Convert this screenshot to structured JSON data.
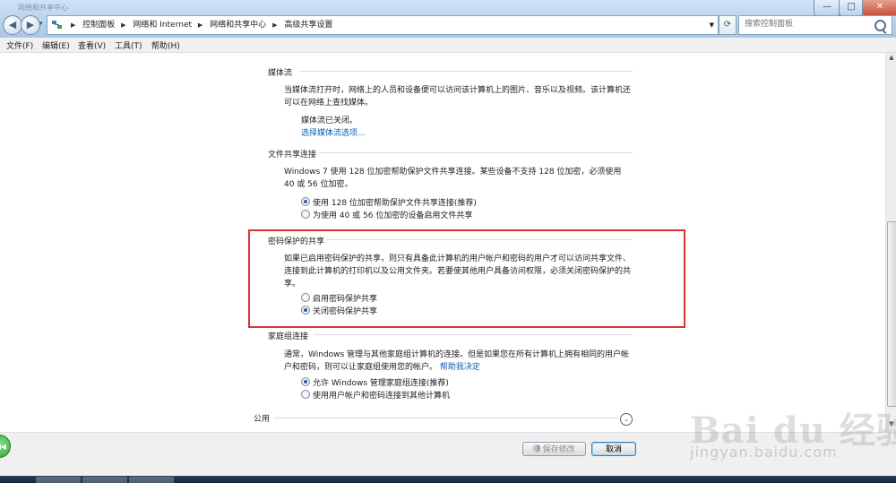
{
  "window": {
    "title": "网络和共享中心",
    "controls": {
      "minimize": "—",
      "maximize": "□",
      "close": "✕"
    }
  },
  "address": {
    "crumbs": [
      "控制面板",
      "网络和 Internet",
      "网络和共享中心",
      "高级共享设置"
    ],
    "search_placeholder": "搜索控制面板"
  },
  "menu": {
    "items": [
      "文件(F)",
      "编辑(E)",
      "查看(V)",
      "工具(T)",
      "帮助(H)"
    ]
  },
  "sections": {
    "media": {
      "title": "媒体流",
      "desc": "当媒体流打开时，网络上的人员和设备便可以访问该计算机上的图片、音乐以及视频。该计算机还可以在网络上查找媒体。",
      "status": "媒体流已关闭。",
      "link": "选择媒体流选项..."
    },
    "file_sharing": {
      "title": "文件共享连接",
      "desc": "Windows 7 使用 128 位加密帮助保护文件共享连接。某些设备不支持 128 位加密，必须使用 40 或 56 位加密。",
      "options": [
        "使用 128 位加密帮助保护文件共享连接(推荐)",
        "为使用 40 或 56 位加密的设备启用文件共享"
      ],
      "selected": 0
    },
    "password": {
      "title": "密码保护的共享",
      "desc": "如果已启用密码保护的共享，则只有具备此计算机的用户帐户和密码的用户才可以访问共享文件、连接到此计算机的打印机以及公用文件夹。若要使其他用户具备访问权限，必须关闭密码保护的共享。",
      "options": [
        "启用密码保护共享",
        "关闭密码保护共享"
      ],
      "selected": 1
    },
    "homegroup": {
      "title": "家庭组连接",
      "desc": "通常，Windows 管理与其他家庭组计算机的连接。但是如果您在所有计算机上拥有相同的用户帐户和密码，则可以让家庭组使用您的帐户。",
      "help_link": "帮助我决定",
      "options": [
        "允许 Windows 管理家庭组连接(推荐)",
        "使用用户帐户和密码连接到其他计算机"
      ],
      "selected": 0
    },
    "public": {
      "title": "公用"
    }
  },
  "buttons": {
    "save": "保存修改",
    "cancel": "取消"
  },
  "watermark": {
    "logo": "Bai du 经验",
    "url": "jingyan.baidu.com"
  },
  "colors": {
    "highlight_border": "#e03131",
    "link": "#0a5fb4",
    "accent": "#2b5ea8"
  }
}
